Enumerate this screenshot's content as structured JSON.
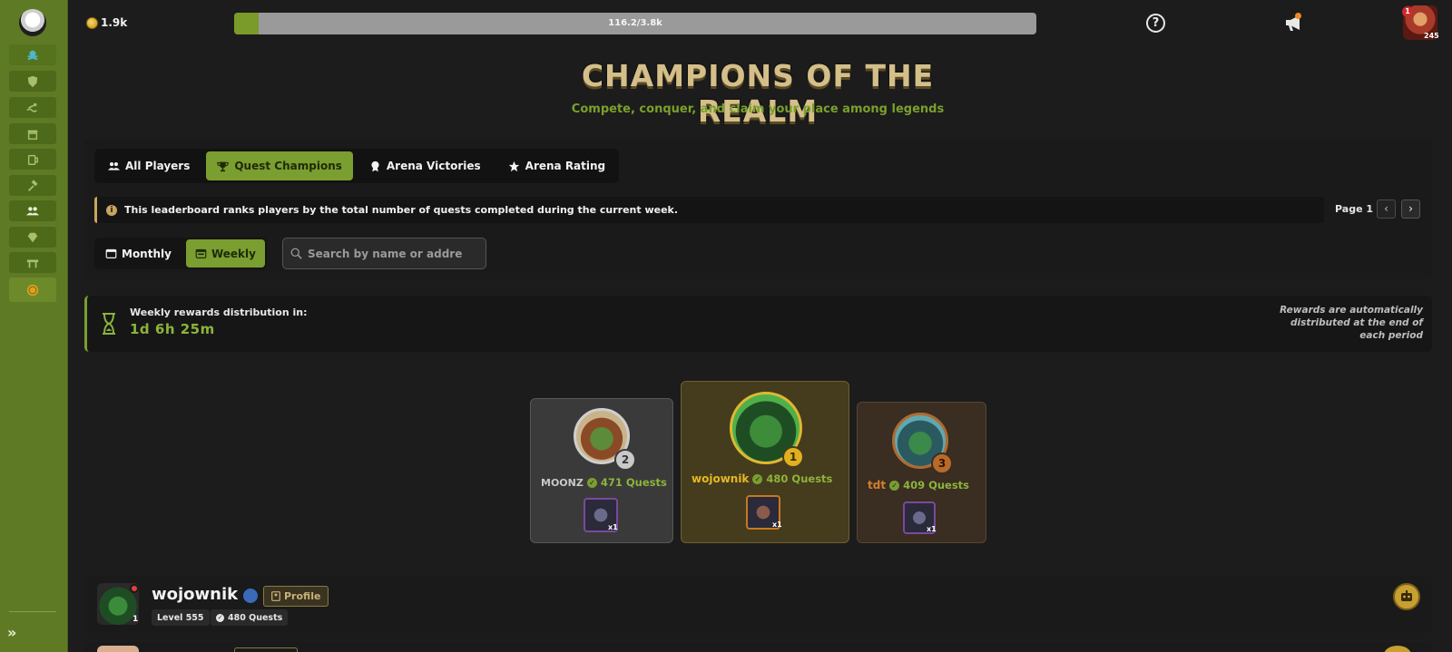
{
  "topbar": {
    "coins": "1.9k",
    "progress": {
      "text": "116.2/3.8k",
      "fraction": 0.03
    },
    "user": {
      "badge": "1",
      "level": "245"
    }
  },
  "header": {
    "title": "CHAMPIONS OF THE REALM",
    "subtitle": "Compete, conquer, and claim your place among legends"
  },
  "tabs": [
    {
      "label": "All Players",
      "icon": "users-icon",
      "active": false
    },
    {
      "label": "Quest Champions",
      "icon": "trophy-icon",
      "active": true
    },
    {
      "label": "Arena Victories",
      "icon": "medal-icon",
      "active": false
    },
    {
      "label": "Arena Rating",
      "icon": "star-icon",
      "active": false
    }
  ],
  "info": {
    "text": "This leaderboard ranks players by the total number of quests completed during the current week.",
    "page_label": "Page 1"
  },
  "period": {
    "monthly": "Monthly",
    "weekly": "Weekly",
    "active": "weekly"
  },
  "search": {
    "placeholder": "Search by name or addre"
  },
  "rewards": {
    "label": "Weekly rewards distribution in:",
    "timer": "1d 6h 25m",
    "note": "Rewards are automatically distributed at the end of each period"
  },
  "podium": {
    "first": {
      "rank": "1",
      "name": "wojownik",
      "quests": "480 Quests",
      "qty": "x1"
    },
    "second": {
      "rank": "2",
      "name": "MOONZ",
      "quests": "471 Quests",
      "qty": "x1"
    },
    "third": {
      "rank": "3",
      "name": "tdt",
      "quests": "409 Quests",
      "qty": "x1"
    }
  },
  "rows": [
    {
      "name": "wojownik",
      "rank": "1",
      "profile": "Profile",
      "level": "Level 555",
      "quests": "480 Quests"
    }
  ],
  "colors": {
    "accent": "#7a9e30",
    "sidebar": "#5f7a24",
    "gold": "#e0b020",
    "silver": "#c9c9c9",
    "bronze": "#b86a2a",
    "title": "#d4bf8a"
  }
}
